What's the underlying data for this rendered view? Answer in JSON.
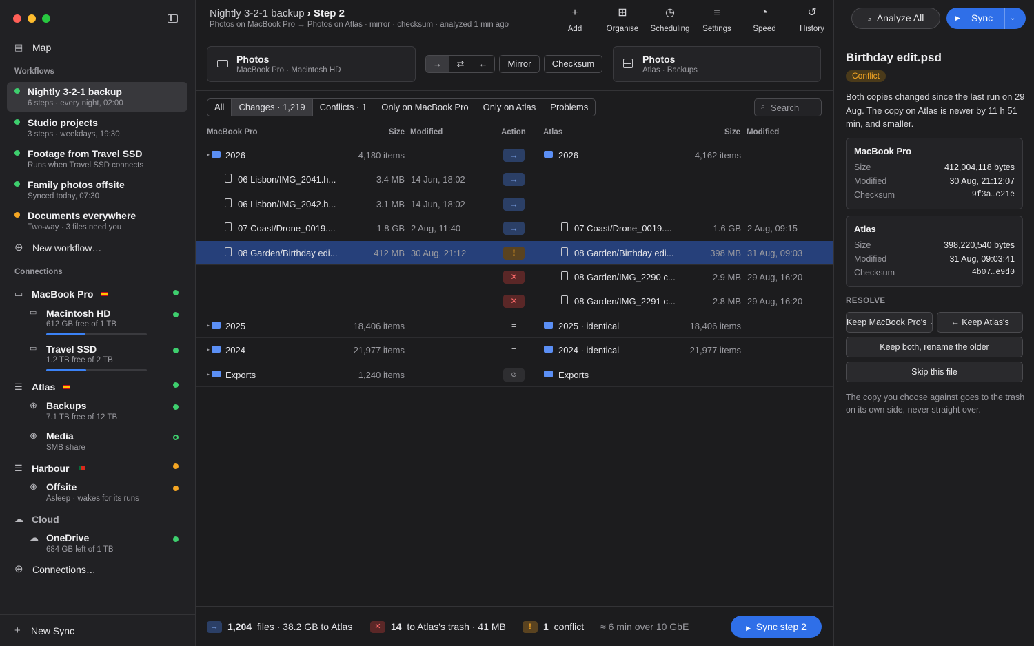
{
  "window": {
    "title": "Nightly 3-2-1 backup",
    "step": "Step 2",
    "subtitle": "Photos on MacBook Pro → Photos on Atlas · mirror · checksum · analyzed 1 min ago"
  },
  "sidebar": {
    "map_label": "Map",
    "workflows_label": "Workflows",
    "workflows": [
      {
        "name": "Nightly 3-2-1 backup",
        "sub": "6 steps · every night, 02:00",
        "status": "green"
      },
      {
        "name": "Studio projects",
        "sub": "3 steps · weekdays, 19:30",
        "status": "green"
      },
      {
        "name": "Footage from Travel SSD",
        "sub": "Runs when Travel SSD connects",
        "status": "green"
      },
      {
        "name": "Family photos offsite",
        "sub": "Synced today, 07:30",
        "status": "green"
      },
      {
        "name": "Documents everywhere",
        "sub": "Two-way · 3 files need you",
        "status": "orange"
      }
    ],
    "new_workflow": "New workflow…",
    "connections_label": "Connections",
    "macbook": "MacBook Pro",
    "macintosh_hd": {
      "name": "Macintosh HD",
      "sub": "612 GB free of 1 TB",
      "used": 0.39
    },
    "travel_ssd": {
      "name": "Travel SSD",
      "sub": "1.2 TB free of 2 TB",
      "used": 0.4
    },
    "atlas": "Atlas",
    "backups": {
      "name": "Backups",
      "sub": "7.1 TB free of 12 TB"
    },
    "media": {
      "name": "Media",
      "sub": "SMB share"
    },
    "harbour": "Harbour",
    "offsite": {
      "name": "Offsite",
      "sub": "Asleep · wakes for its runs"
    },
    "cloud": "Cloud",
    "onedrive": {
      "name": "OneDrive",
      "sub": "684 GB left of 1 TB"
    },
    "connections_more": "Connections…",
    "new_sync": "New Sync"
  },
  "toolbar": {
    "add": "Add",
    "organise": "Organise",
    "scheduling": "Scheduling",
    "settings": "Settings",
    "speed": "Speed",
    "history": "History",
    "analyze_all": "Analyze All",
    "sync": "Sync"
  },
  "source": {
    "title": "Photos",
    "sub": "MacBook Pro · Macintosh HD"
  },
  "target": {
    "title": "Photos",
    "sub": "Atlas · Backups"
  },
  "modes": {
    "mirror": "Mirror",
    "checksum": "Checksum"
  },
  "filters": [
    "All",
    "Changes · 1,219",
    "Conflicts · 1",
    "Only on MacBook Pro",
    "Only on Atlas",
    "Problems"
  ],
  "search_placeholder": "Search",
  "columns": {
    "left_name": "MacBook Pro",
    "size": "Size",
    "modified": "Modified",
    "action": "Action",
    "right_name": "Atlas",
    "rsize": "Size",
    "rmodified": "Modified"
  },
  "rows": [
    {
      "kind": "folder",
      "l_name": "2026",
      "l_size": "4,180 items",
      "l_mod": "",
      "action": "→",
      "act_type": "arrow",
      "r_kind": "folder",
      "r_name": "2026",
      "r_size": "4,162 items",
      "r_mod": ""
    },
    {
      "kind": "file",
      "l_name": "06 Lisbon/IMG_2041.h...",
      "l_size": "3.4 MB",
      "l_mod": "14 Jun, 18:02",
      "action": "→",
      "act_type": "arrow",
      "r_kind": "none",
      "r_name": "—",
      "r_size": "",
      "r_mod": ""
    },
    {
      "kind": "file",
      "l_name": "06 Lisbon/IMG_2042.h...",
      "l_size": "3.1 MB",
      "l_mod": "14 Jun, 18:02",
      "action": "→",
      "act_type": "arrow",
      "r_kind": "none",
      "r_name": "—",
      "r_size": "",
      "r_mod": ""
    },
    {
      "kind": "file",
      "l_name": "07 Coast/Drone_0019....",
      "l_size": "1.8 GB",
      "l_mod": "2 Aug, 11:40",
      "action": "→",
      "act_type": "arrow",
      "r_kind": "file",
      "r_name": "07 Coast/Drone_0019....",
      "r_size": "1.6 GB",
      "r_mod": "2 Aug, 09:15"
    },
    {
      "kind": "file",
      "l_name": "08 Garden/Birthday edi...",
      "l_size": "412 MB",
      "l_mod": "30 Aug, 21:12",
      "action": "!",
      "act_type": "warn",
      "r_kind": "file",
      "r_name": "08 Garden/Birthday edi...",
      "r_size": "398 MB",
      "r_mod": "31 Aug, 09:03",
      "selected": true
    },
    {
      "kind": "none",
      "l_name": "—",
      "l_size": "",
      "l_mod": "",
      "action": "✕",
      "act_type": "del",
      "r_kind": "file",
      "r_name": "08 Garden/IMG_2290 c...",
      "r_size": "2.9 MB",
      "r_mod": "29 Aug, 16:20"
    },
    {
      "kind": "none",
      "l_name": "—",
      "l_size": "",
      "l_mod": "",
      "action": "✕",
      "act_type": "del",
      "r_kind": "file",
      "r_name": "08 Garden/IMG_2291 c...",
      "r_size": "2.8 MB",
      "r_mod": "29 Aug, 16:20"
    },
    {
      "kind": "folder",
      "l_name": "2025",
      "l_size": "18,406 items",
      "l_mod": "",
      "action": "=",
      "act_type": "eq",
      "r_kind": "folder",
      "r_name": "2025 · identical",
      "r_size": "18,406 items",
      "r_mod": ""
    },
    {
      "kind": "folder",
      "l_name": "2024",
      "l_size": "21,977 items",
      "l_mod": "",
      "action": "=",
      "act_type": "eq",
      "r_kind": "folder",
      "r_name": "2024 · identical",
      "r_size": "21,977 items",
      "r_mod": ""
    },
    {
      "kind": "folder",
      "l_name": "Exports",
      "l_size": "1,240 items",
      "l_mod": "",
      "action": "⊘",
      "act_type": "skip",
      "r_kind": "folder",
      "r_name": "Exports",
      "r_size": "",
      "r_mod": ""
    }
  ],
  "footer": {
    "files_count": "1,204",
    "files_text": "files · 38.2 GB to Atlas",
    "trash_count": "14",
    "trash_text": "to Atlas's trash · 41 MB",
    "conflict_count": "1",
    "conflict_text": "conflict",
    "eta": "≈ 6 min over 10 GbE",
    "sync_step": "Sync step 2"
  },
  "inspector": {
    "title": "Birthday edit.psd",
    "badge": "Conflict",
    "description": "Both copies changed since the last run on 29 Aug. The copy on Atlas is newer by 11 h 51 min, and smaller.",
    "mbp": {
      "title": "MacBook Pro",
      "size_label": "Size",
      "size": "412,004,118 bytes",
      "mod_label": "Modified",
      "mod": "30 Aug, 21:12:07",
      "ck_label": "Checksum",
      "ck": "9f3a…c21e"
    },
    "atlas": {
      "title": "Atlas",
      "size_label": "Size",
      "size": "398,220,540 bytes",
      "mod_label": "Modified",
      "mod": "31 Aug, 09:03:41",
      "ck_label": "Checksum",
      "ck": "4b07…e9d0"
    },
    "resolve_label": "RESOLVE",
    "keep_mbp": "Keep MacBook Pro's →",
    "keep_atlas": "← Keep Atlas's",
    "keep_both": "Keep both, rename the older",
    "skip": "Skip this file",
    "note": "The copy you choose against goes to the trash on its own side, never straight over."
  }
}
